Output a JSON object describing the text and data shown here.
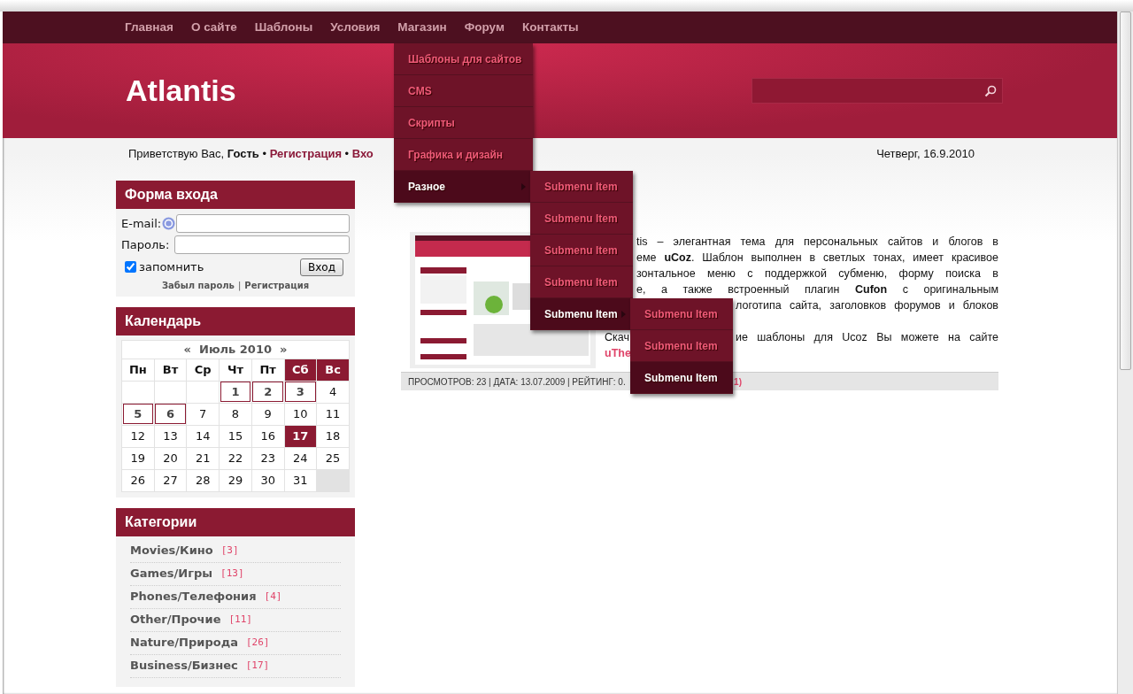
{
  "nav": [
    "Главная",
    "О сайте",
    "Шаблоны",
    "Условия",
    "Магазин",
    "Форум",
    "Контакты"
  ],
  "logo": "Atlantis",
  "welcome": {
    "text": "Приветствую Вас, **Гость** • ",
    "link1": "Регистрация",
    "sep": " • ",
    "link2": "Вхо"
  },
  "date": "Четверг, 16.9.2010",
  "menu": [
    {
      "label": "Шаблоны для сайтов",
      "selected": false,
      "has_submenu": false
    },
    {
      "label": "CMS",
      "selected": false,
      "has_submenu": false
    },
    {
      "label": "Скрипты",
      "selected": false,
      "has_submenu": false
    },
    {
      "label": "Графика и дизайн",
      "selected": false,
      "has_submenu": false
    },
    {
      "label": "Разное",
      "selected": true,
      "has_submenu": true
    }
  ],
  "submenu": [
    {
      "label": "Submenu Item",
      "selected": false,
      "has_submenu": false
    },
    {
      "label": "Submenu Item",
      "selected": false,
      "has_submenu": false
    },
    {
      "label": "Submenu Item",
      "selected": false,
      "has_submenu": false
    },
    {
      "label": "Submenu Item",
      "selected": false,
      "has_submenu": false
    },
    {
      "label": "Submenu Item",
      "selected": true,
      "has_submenu": true
    }
  ],
  "submenu2": [
    {
      "label": "Submenu Item",
      "selected": false,
      "has_submenu": false
    },
    {
      "label": "Submenu Item",
      "selected": false,
      "has_submenu": false
    },
    {
      "label": "Submenu Item",
      "selected": true,
      "has_submenu": false
    }
  ],
  "login": {
    "title": "Форма входа",
    "email_label": "E-mail:",
    "password_label": "Пароль:",
    "remember": "запомнить",
    "remember_checked": true,
    "submit": "Вход",
    "forgot": "Забыл пароль",
    "sep": "|",
    "register": "Регистрация"
  },
  "calendar": {
    "title": "Календарь",
    "prev": "«",
    "month": "Июль 2010",
    "next": "»",
    "weekdays": [
      {
        "label": "Пн",
        "weekend": false
      },
      {
        "label": "Вт",
        "weekend": false
      },
      {
        "label": "Ср",
        "weekend": false
      },
      {
        "label": "Чт",
        "weekend": false
      },
      {
        "label": "Пт",
        "weekend": false
      },
      {
        "label": "Сб",
        "weekend": true
      },
      {
        "label": "Вс",
        "weekend": true
      }
    ],
    "weeks": [
      [
        {
          "kind": "blank"
        },
        {
          "kind": "blank"
        },
        {
          "kind": "blank"
        },
        {
          "day": "1",
          "kind": "entry"
        },
        {
          "day": "2",
          "kind": "entry"
        },
        {
          "day": "3",
          "kind": "entry"
        },
        {
          "day": "4",
          "kind": "plain"
        }
      ],
      [
        {
          "day": "5",
          "kind": "entry"
        },
        {
          "day": "6",
          "kind": "entry"
        },
        {
          "day": "7",
          "kind": "plain"
        },
        {
          "day": "8",
          "kind": "plain"
        },
        {
          "day": "9",
          "kind": "plain"
        },
        {
          "day": "10",
          "kind": "plain"
        },
        {
          "day": "11",
          "kind": "plain"
        }
      ],
      [
        {
          "day": "12",
          "kind": "plain"
        },
        {
          "day": "13",
          "kind": "plain"
        },
        {
          "day": "14",
          "kind": "plain"
        },
        {
          "day": "15",
          "kind": "plain"
        },
        {
          "day": "16",
          "kind": "plain"
        },
        {
          "day": "17",
          "kind": "today"
        },
        {
          "day": "18",
          "kind": "plain"
        }
      ],
      [
        {
          "day": "19",
          "kind": "plain"
        },
        {
          "day": "20",
          "kind": "plain"
        },
        {
          "day": "21",
          "kind": "plain"
        },
        {
          "day": "22",
          "kind": "plain"
        },
        {
          "day": "23",
          "kind": "plain"
        },
        {
          "day": "24",
          "kind": "plain"
        },
        {
          "day": "25",
          "kind": "plain"
        }
      ],
      [
        {
          "day": "26",
          "kind": "plain"
        },
        {
          "day": "27",
          "kind": "plain"
        },
        {
          "day": "28",
          "kind": "plain"
        },
        {
          "day": "29",
          "kind": "plain"
        },
        {
          "day": "30",
          "kind": "plain"
        },
        {
          "day": "31",
          "kind": "plain"
        },
        {
          "kind": "filler"
        }
      ]
    ]
  },
  "categories": {
    "title": "Категории",
    "items": [
      {
        "name": "Movies/Кино",
        "count": "[3]"
      },
      {
        "name": "Games/Игры",
        "count": "[13]"
      },
      {
        "name": "Phones/Телефония",
        "count": "[4]"
      },
      {
        "name": "Other/Прочие",
        "count": "[11]"
      },
      {
        "name": "Nature/Природа",
        "count": "[26]"
      },
      {
        "name": "Business/Бизнес",
        "count": "[17]"
      }
    ]
  },
  "article": {
    "lines": [
      {
        "kind": "after_submenu",
        "parts": [
          "tis – элегантная тема для персональных сайтов и блогов в"
        ]
      },
      {
        "kind": "after_submenu",
        "parts": [
          "еме **uCoz**. Шаблон выполнен в светлых тонах, имеет красивое"
        ]
      },
      {
        "kind": "after_submenu",
        "parts": [
          "зонтальное меню с поддержкой субменю, форму поиска в"
        ]
      },
      {
        "kind": "after_submenu",
        "parts": [
          "е, а также встроенный плагин **Cufon** с оригинальным"
        ]
      },
      {
        "kind": "after_submenu2",
        "parts": [
          "логотипа сайта, заголовков форумов и блоков"
        ]
      },
      {
        "kind": "split",
        "parts": [
          "Скач",
          "ие шаблоны для Ucoz Вы можете на сайте"
        ]
      },
      {
        "kind": "link",
        "parts": [
          "uThe"
        ]
      }
    ],
    "info": "ПРОСМОТРОВ: 23 | ДАТА: 13.07.2009 | РЕЙТИНГ: 0.",
    "info_tail": "1)"
  }
}
